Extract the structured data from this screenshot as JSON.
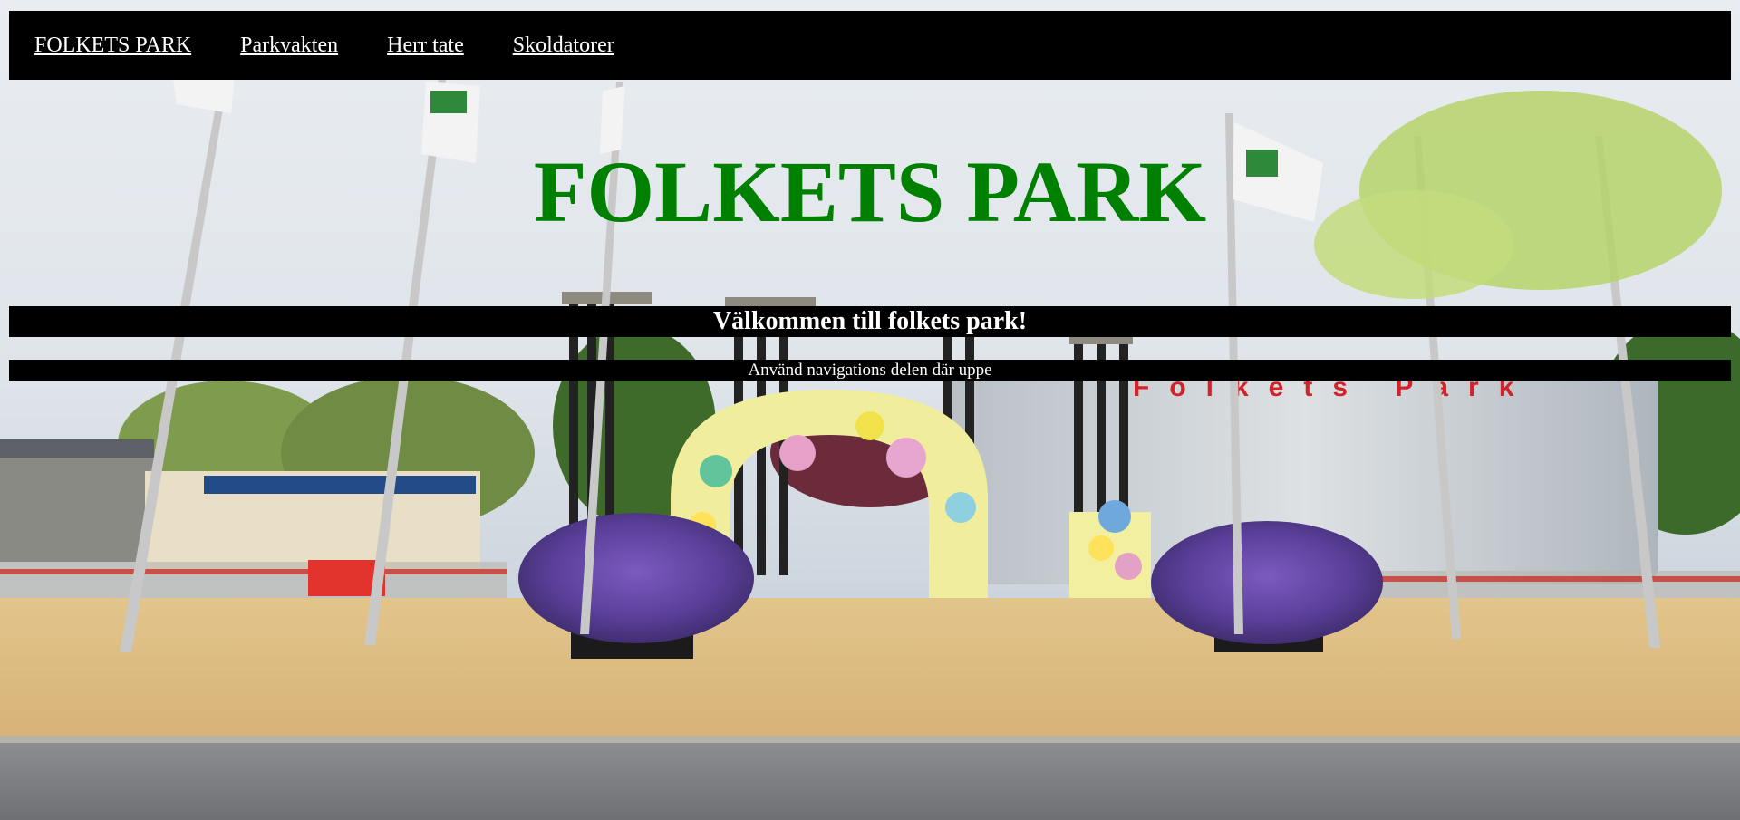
{
  "nav": {
    "items": [
      {
        "label": "FOLKETS PARK"
      },
      {
        "label": "Parkvakten"
      },
      {
        "label": "Herr tate"
      },
      {
        "label": "Skoldatorer"
      }
    ]
  },
  "hero": {
    "title": "FOLKETS PARK"
  },
  "welcome": {
    "heading": "Välkommen till folkets park!",
    "hint": "Använd navigations delen där uppe"
  },
  "background": {
    "building_sign": "Folkets Park"
  },
  "colors": {
    "title": "#008000",
    "bars": "#000000",
    "bar_text": "#ffffff"
  }
}
